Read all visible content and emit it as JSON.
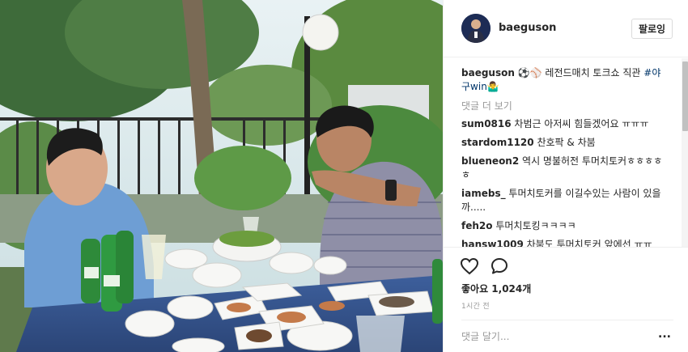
{
  "post": {
    "image_alt": "Two men talking at an outdoor dinner table in a garden"
  },
  "header": {
    "username": "baeguson",
    "follow_label": "팔로잉"
  },
  "caption": {
    "username": "baeguson",
    "text": "⚽⚾ 레전드매치 토크쇼 직관",
    "hashtag": "#야구win",
    "trailing_emoji": "🤷‍♂"
  },
  "load_more_label": "댓글 더 보기",
  "comments": [
    {
      "username": "sum0816",
      "text": "차범근 아저씨 힘들겠어요 ㅠㅠㅠ"
    },
    {
      "username": "stardom1120",
      "text": "찬호팍 & 차붐"
    },
    {
      "username": "blueneon2",
      "text": "역시 명불허전 투머치토커ㅎㅎㅎㅎㅎ"
    },
    {
      "username": "iamebs_",
      "text": "투머치토커를 이길수있는 사람이 있을까....."
    },
    {
      "username": "feh2o",
      "text": "투머치토킹ㅋㅋㅋㅋ"
    },
    {
      "username": "hansw1009",
      "text": "차붐도 투머치토커 앞에선 ㅠㅠ"
    }
  ],
  "actions": {
    "like_icon": "heart-outline-icon",
    "comment_icon": "speech-bubble-icon"
  },
  "likes_text": "좋아요 1,024개",
  "timestamp": "1시간 전",
  "comment_input": {
    "placeholder": "댓글 달기..."
  },
  "more_options_label": "..."
}
